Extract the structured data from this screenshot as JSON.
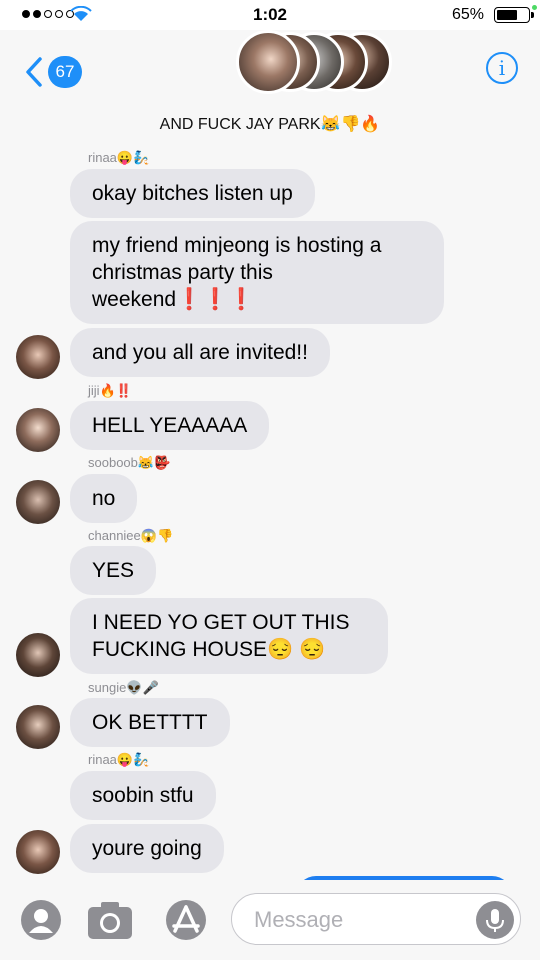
{
  "status_bar": {
    "time": "1:02",
    "battery_percent": "65%"
  },
  "header": {
    "back_count": "67",
    "group_title": "AND FUCK JAY PARK😹👎🔥",
    "info_label": "i"
  },
  "messages": [
    {
      "sender": "rinaa😛🧞",
      "bubbles": [
        "okay bitches listen up",
        "my friend minjeong is hosting a christmas party this weekend❗️❗️❗️",
        "and you all are invited!!"
      ]
    },
    {
      "sender": "jiji🔥‼️",
      "bubbles": [
        "HELL YEAAAAA"
      ]
    },
    {
      "sender": "sooboob😹👺",
      "bubbles": [
        "no"
      ]
    },
    {
      "sender": "channiee😱👎",
      "bubbles": [
        "YES",
        "I NEED YO GET OUT THIS FUCKING HOUSE😔 😔"
      ]
    },
    {
      "sender": "sungie👽🎤",
      "bubbles": [
        "OK BETTTT"
      ]
    },
    {
      "sender": "rinaa😛🧞",
      "bubbles": [
        "soobin stfu",
        "youre going"
      ]
    }
  ],
  "input": {
    "placeholder": "Message"
  },
  "icons": {
    "back": "chevron-left-icon",
    "info": "info-icon",
    "contact": "contact-icon",
    "camera": "camera-icon",
    "appstore": "appstore-icon",
    "mic": "microphone-icon"
  },
  "colors": {
    "accent": "#1e8ff8",
    "bubble_received": "#e5e5ea",
    "bubble_sent": "#1e7ef0"
  }
}
